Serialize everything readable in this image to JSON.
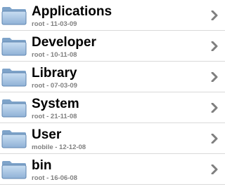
{
  "items": [
    {
      "name": "Applications",
      "meta": "root - 11-03-09",
      "icon": "folder-icon"
    },
    {
      "name": "Developer",
      "meta": "root - 10-11-08",
      "icon": "folder-icon"
    },
    {
      "name": "Library",
      "meta": "root - 07-03-09",
      "icon": "folder-icon"
    },
    {
      "name": "System",
      "meta": "root - 21-11-08",
      "icon": "folder-icon"
    },
    {
      "name": "User",
      "meta": "mobile - 12-12-08",
      "icon": "folder-icon"
    },
    {
      "name": "bin",
      "meta": "root - 16-06-08",
      "icon": "folder-icon"
    }
  ],
  "colors": {
    "folder_light": "#b8d3ec",
    "folder_dark": "#6f95bd",
    "subtitle": "#808080",
    "chevron": "#7f7f7f",
    "separator": "#d9d9d9"
  }
}
